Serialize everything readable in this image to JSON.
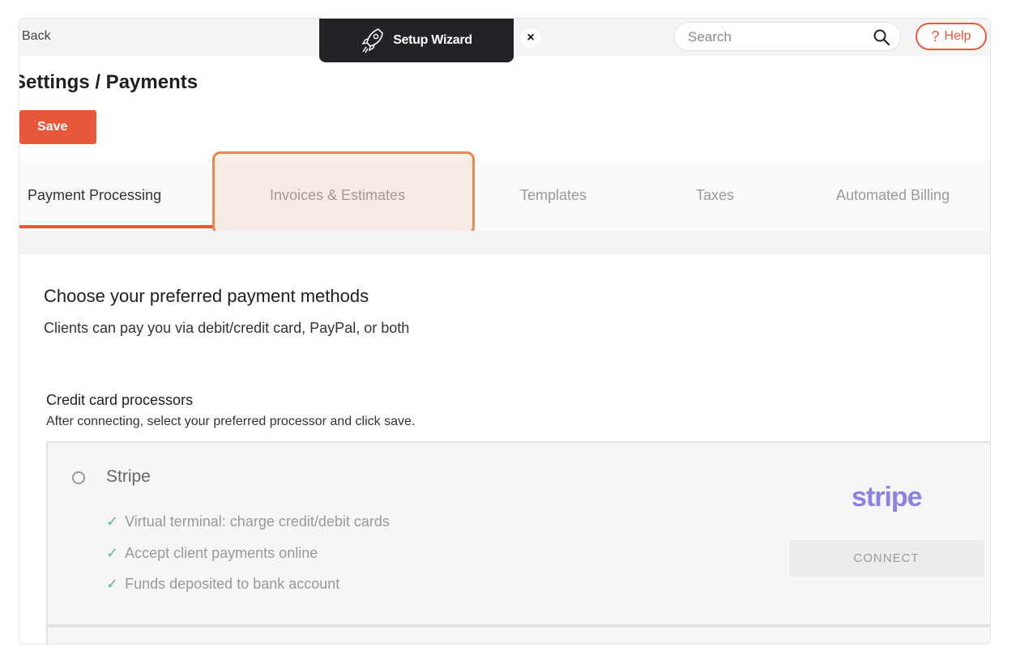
{
  "topbar": {
    "back_label": "Back",
    "wizard_label": "Setup Wizard",
    "wizard_close": "×",
    "search_placeholder": "Search",
    "help_icon": "?",
    "help_label": "Help"
  },
  "page": {
    "title": "Settings / Payments",
    "save_label": "Save"
  },
  "tabs": [
    {
      "label": "Payment Processing",
      "active": true
    },
    {
      "label": "Invoices & Estimates",
      "active": false,
      "highlighted": true
    },
    {
      "label": "Templates",
      "active": false
    },
    {
      "label": "Taxes",
      "active": false
    },
    {
      "label": "Automated Billing",
      "active": false
    }
  ],
  "content": {
    "heading": "Choose your preferred payment methods",
    "subheading": "Clients can pay you via debit/credit card, PayPal, or both",
    "cc_heading": "Credit card processors",
    "cc_subheading": "After connecting, select your preferred processor and click save."
  },
  "processor": {
    "name": "Stripe",
    "logo_text": "stripe",
    "features": [
      "Virtual terminal: charge credit/debit cards",
      "Accept client payments online",
      "Funds deposited to bank account"
    ],
    "connect_label": "CONNECT"
  },
  "colors": {
    "accent": "#e8573a",
    "check": "#5cb98b",
    "stripe": "#8a83e6",
    "wizard_bg": "#222326"
  },
  "icons": {
    "wizard": "rocket-icon",
    "search": "search-icon",
    "check": "check-icon",
    "help": "question-icon"
  }
}
